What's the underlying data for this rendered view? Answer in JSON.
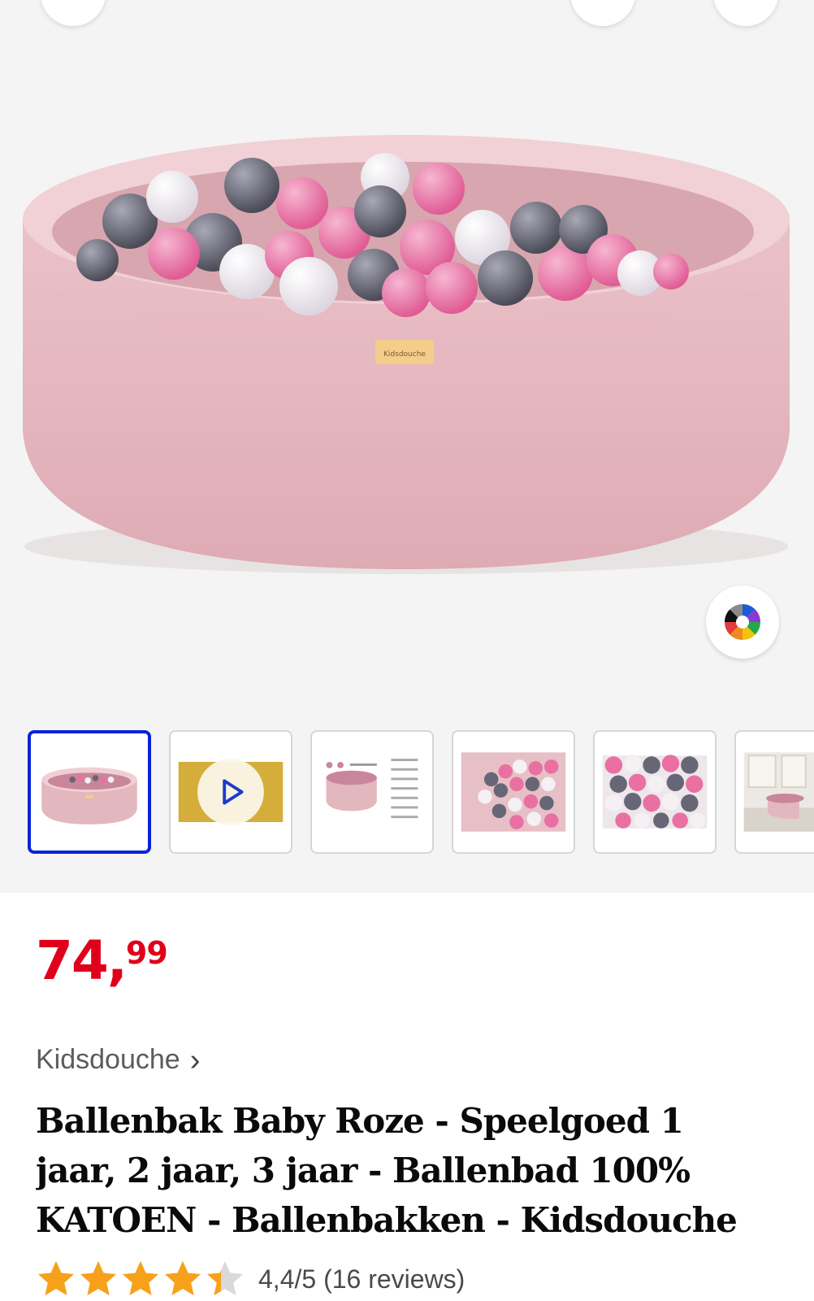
{
  "product": {
    "price_whole": "74,",
    "price_cents": "99",
    "brand": "Kidsdouche",
    "brand_chevron": "›",
    "title": "Ballenbak Baby Roze - Speelgoed 1 jaar, 2 jaar, 3 jaar - Ballenbad 100% KATOEN - Ballenbakken - Kidsdouche",
    "rating_text": "4,4/5 (16 reviews)",
    "rating_value": 4.4,
    "rating_max": 5,
    "label_text": "Kidsdouche"
  },
  "gallery": {
    "thumbnails": [
      {
        "kind": "product",
        "selected": true
      },
      {
        "kind": "video",
        "selected": false
      },
      {
        "kind": "infographic",
        "selected": false
      },
      {
        "kind": "balls-closeup",
        "selected": false
      },
      {
        "kind": "balls-topdown",
        "selected": false
      },
      {
        "kind": "room",
        "selected": false
      }
    ],
    "icons": {
      "color_picker": "color-wheel-icon",
      "play": "play-icon"
    }
  },
  "colors": {
    "price": "#e0001b",
    "selected_border": "#0a22d8",
    "star": "#f7a11b",
    "pool_pink": "#e8bcc3",
    "ball_pink": "#ea70a2",
    "ball_grey": "#6a6a78",
    "ball_white": "#f2eef3"
  }
}
